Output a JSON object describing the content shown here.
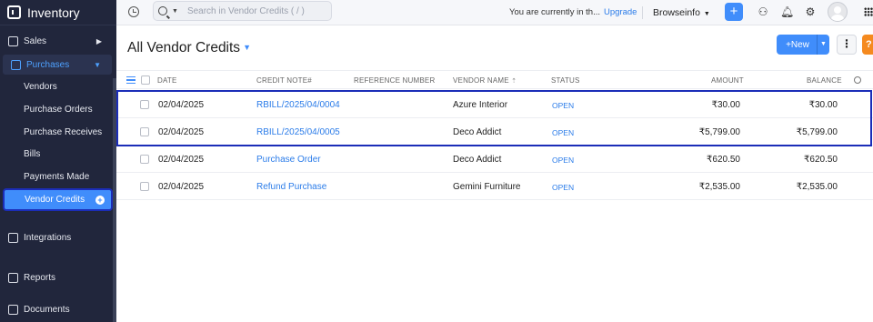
{
  "app": {
    "name": "Inventory"
  },
  "sidebar": {
    "items": [
      {
        "label": "Sales",
        "arrow": "▶"
      },
      {
        "label": "Purchases",
        "arrow": "▼"
      },
      {
        "label": "Vendors"
      },
      {
        "label": "Purchase Orders"
      },
      {
        "label": "Purchase Receives"
      },
      {
        "label": "Bills"
      },
      {
        "label": "Payments Made"
      },
      {
        "label": "Vendor Credits",
        "action": "+"
      },
      {
        "label": "Integrations"
      },
      {
        "label": "Reports"
      },
      {
        "label": "Documents"
      }
    ]
  },
  "topbar": {
    "search_placeholder": "Search in Vendor Credits ( / )",
    "trial_text": "You are currently in th...",
    "upgrade_label": "Upgrade",
    "org_name": "Browseinfo",
    "quick_add": "+"
  },
  "page": {
    "title": "All Vendor Credits",
    "new_label": "+New",
    "more_label": "⋮",
    "help_label": "?"
  },
  "table": {
    "columns": [
      "DATE",
      "CREDIT NOTE#",
      "REFERENCE NUMBER",
      "VENDOR NAME",
      "STATUS",
      "AMOUNT",
      "BALANCE"
    ],
    "rows": [
      {
        "date": "02/04/2025",
        "credit_note": "RBILL/2025/04/0004",
        "reference": "",
        "vendor": "Azure Interior",
        "status": "OPEN",
        "amount": "₹30.00",
        "balance": "₹30.00"
      },
      {
        "date": "02/04/2025",
        "credit_note": "RBILL/2025/04/0005",
        "reference": "",
        "vendor": "Deco Addict",
        "status": "OPEN",
        "amount": "₹5,799.00",
        "balance": "₹5,799.00"
      },
      {
        "date": "02/04/2025",
        "credit_note": "Purchase Order",
        "reference": "",
        "vendor": "Deco Addict",
        "status": "OPEN",
        "amount": "₹620.50",
        "balance": "₹620.50"
      },
      {
        "date": "02/04/2025",
        "credit_note": "Refund Purchase",
        "reference": "",
        "vendor": "Gemini Furniture",
        "status": "OPEN",
        "amount": "₹2,535.00",
        "balance": "₹2,535.00"
      }
    ]
  },
  "colors": {
    "accent": "#408dfb",
    "sidebar_bg": "#21263c",
    "highlight": "#1b2db8",
    "help": "#f58a1f"
  },
  "icons": [
    "brand-icon",
    "history-icon",
    "search-icon",
    "users-icon",
    "bell-icon",
    "gear-icon",
    "apps-icon",
    "filter-icon",
    "sort-icon",
    "column-search-icon"
  ]
}
